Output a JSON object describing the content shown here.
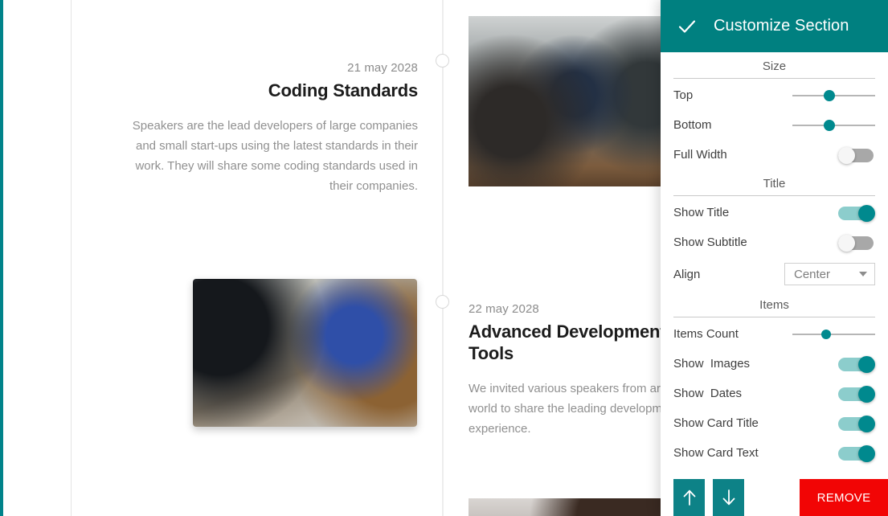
{
  "canvas": {
    "accent_strip_color": "#00838a",
    "timeline": {
      "items": [
        {
          "date": "21 may 2028",
          "title": "Coding Standards",
          "text": "Speakers are the lead developers of large companies and small start-ups using the latest standards in their work. They will share some coding standards used in their companies.",
          "image_alt": "business-meeting-photo"
        },
        {
          "date": "22 may 2028",
          "title": "Advanced Development Tools",
          "text": "We invited various speakers from around the world to share the leading development experience.",
          "image_alt": "people-at-table-photo"
        }
      ]
    }
  },
  "panel": {
    "header": {
      "title": "Customize Section",
      "confirm_icon": "check-icon",
      "background_color": "#008080"
    },
    "sections": {
      "size": {
        "heading": "Size",
        "top_label": "Top",
        "top_value": 45,
        "bottom_label": "Bottom",
        "bottom_value": 45,
        "full_width_label": "Full Width",
        "full_width_state": "off"
      },
      "title": {
        "heading": "Title",
        "show_title_label": "Show Title",
        "show_title_state": "on",
        "show_subtitle_label": "Show Subtitle",
        "show_subtitle_state": "off",
        "align_label": "Align",
        "align_value": "Center"
      },
      "items": {
        "heading": "Items",
        "items_count_label": "Items Count",
        "items_count_value": 41,
        "show_images_label": "Show  Images",
        "show_images_state": "on",
        "show_dates_label": "Show  Dates",
        "show_dates_state": "on",
        "show_card_title_label": "Show Card Title",
        "show_card_title_state": "on",
        "show_card_text_label": "Show Card Text",
        "show_card_text_state": "on"
      }
    },
    "footer": {
      "move_up_icon": "arrow-up-icon",
      "move_down_icon": "arrow-down-icon",
      "remove_label": "REMOVE",
      "remove_color": "#f20505"
    }
  }
}
